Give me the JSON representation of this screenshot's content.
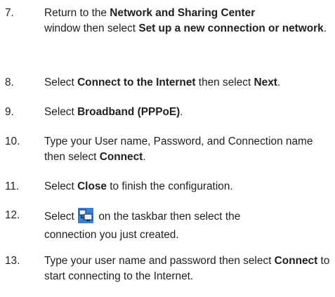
{
  "steps": [
    {
      "num": "7.",
      "parts": [
        "Return to the ",
        "Network and Sharing Center",
        " window then select ",
        "Set up a new connection or network",
        "."
      ]
    },
    {
      "num": "8.",
      "parts": [
        "Select ",
        "Connect to the Internet",
        " then select ",
        "Next",
        "."
      ]
    },
    {
      "num": "9.",
      "parts": [
        "Select ",
        "Broadband (PPPoE)",
        "."
      ]
    },
    {
      "num": "10.",
      "parts": [
        "Type your User name, Password, and Connection name then select ",
        "Connect",
        "."
      ]
    },
    {
      "num": "11.",
      "parts": [
        "Select ",
        "Close",
        " to finish the configuration."
      ]
    },
    {
      "num": "12.",
      "parts_a": "Select ",
      "icon": "network-taskbar-icon",
      "parts_b": " on the taskbar then select the",
      "line2": "connection you just created."
    },
    {
      "num": "13.",
      "parts": [
        "Type your user name and password then select ",
        "Connect",
        " to start connecting to the Internet."
      ]
    }
  ]
}
